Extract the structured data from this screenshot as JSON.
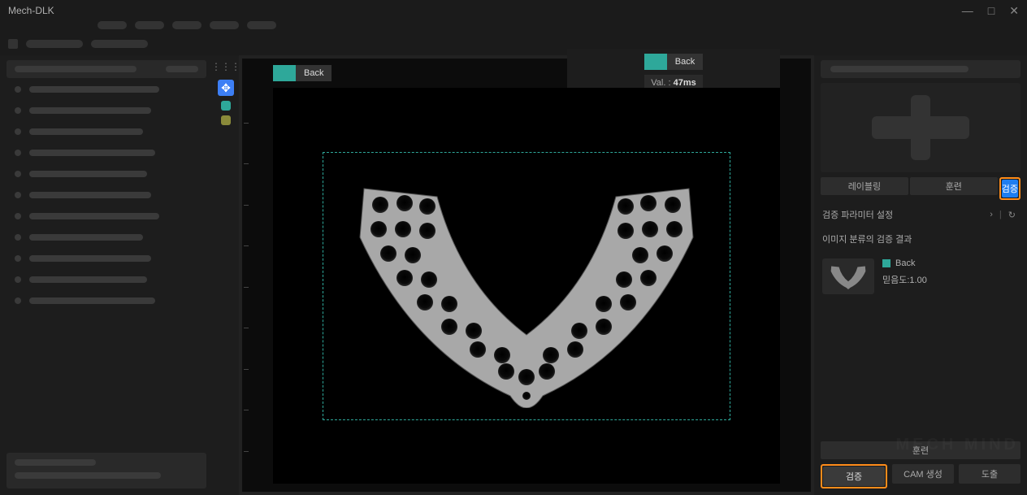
{
  "app": {
    "title": "Mech-DLK"
  },
  "canvas": {
    "left_chip": "Back",
    "right_chip": "Back",
    "val_label": "Val. :",
    "val_value": "47ms"
  },
  "right_panel": {
    "tabs": {
      "labeling": "레이블링",
      "training": "훈련",
      "validation": "검증"
    },
    "param_section": "검증 파라미터 설정",
    "result_section": "이미지 분류의 검증 결과",
    "result": {
      "label": "Back",
      "confidence_label": "믿음도:",
      "confidence_value": "1.00"
    },
    "train_btn": "훈련",
    "buttons": {
      "validate": "검증",
      "cam": "CAM 생성",
      "export": "도출"
    }
  },
  "watermark": "MECH MIND"
}
